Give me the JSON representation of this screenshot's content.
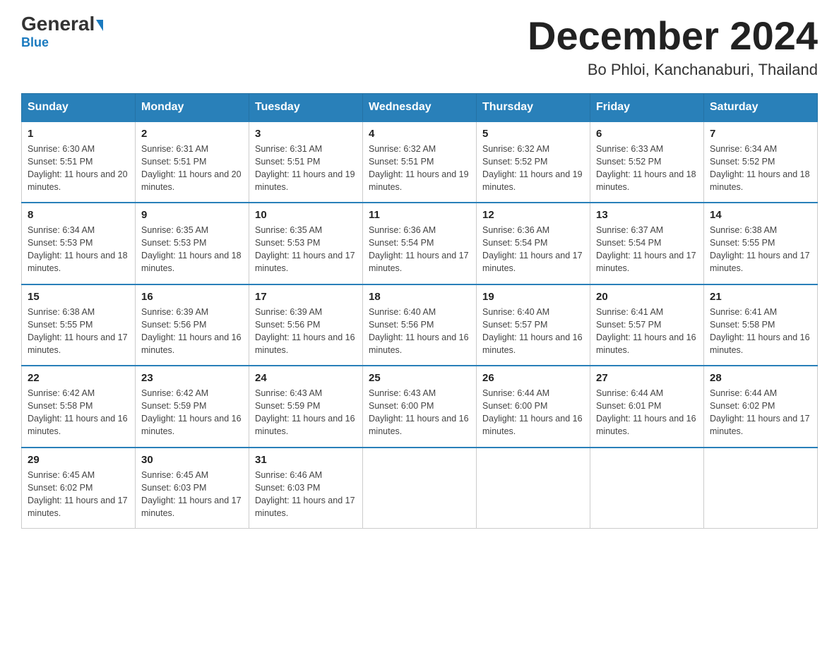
{
  "header": {
    "logo_general": "General",
    "logo_blue": "Blue",
    "month_title": "December 2024",
    "location": "Bo Phloi, Kanchanaburi, Thailand"
  },
  "weekdays": [
    "Sunday",
    "Monday",
    "Tuesday",
    "Wednesday",
    "Thursday",
    "Friday",
    "Saturday"
  ],
  "weeks": [
    [
      {
        "day": "1",
        "sunrise": "6:30 AM",
        "sunset": "5:51 PM",
        "daylight": "11 hours and 20 minutes."
      },
      {
        "day": "2",
        "sunrise": "6:31 AM",
        "sunset": "5:51 PM",
        "daylight": "11 hours and 20 minutes."
      },
      {
        "day": "3",
        "sunrise": "6:31 AM",
        "sunset": "5:51 PM",
        "daylight": "11 hours and 19 minutes."
      },
      {
        "day": "4",
        "sunrise": "6:32 AM",
        "sunset": "5:51 PM",
        "daylight": "11 hours and 19 minutes."
      },
      {
        "day": "5",
        "sunrise": "6:32 AM",
        "sunset": "5:52 PM",
        "daylight": "11 hours and 19 minutes."
      },
      {
        "day": "6",
        "sunrise": "6:33 AM",
        "sunset": "5:52 PM",
        "daylight": "11 hours and 18 minutes."
      },
      {
        "day": "7",
        "sunrise": "6:34 AM",
        "sunset": "5:52 PM",
        "daylight": "11 hours and 18 minutes."
      }
    ],
    [
      {
        "day": "8",
        "sunrise": "6:34 AM",
        "sunset": "5:53 PM",
        "daylight": "11 hours and 18 minutes."
      },
      {
        "day": "9",
        "sunrise": "6:35 AM",
        "sunset": "5:53 PM",
        "daylight": "11 hours and 18 minutes."
      },
      {
        "day": "10",
        "sunrise": "6:35 AM",
        "sunset": "5:53 PM",
        "daylight": "11 hours and 17 minutes."
      },
      {
        "day": "11",
        "sunrise": "6:36 AM",
        "sunset": "5:54 PM",
        "daylight": "11 hours and 17 minutes."
      },
      {
        "day": "12",
        "sunrise": "6:36 AM",
        "sunset": "5:54 PM",
        "daylight": "11 hours and 17 minutes."
      },
      {
        "day": "13",
        "sunrise": "6:37 AM",
        "sunset": "5:54 PM",
        "daylight": "11 hours and 17 minutes."
      },
      {
        "day": "14",
        "sunrise": "6:38 AM",
        "sunset": "5:55 PM",
        "daylight": "11 hours and 17 minutes."
      }
    ],
    [
      {
        "day": "15",
        "sunrise": "6:38 AM",
        "sunset": "5:55 PM",
        "daylight": "11 hours and 17 minutes."
      },
      {
        "day": "16",
        "sunrise": "6:39 AM",
        "sunset": "5:56 PM",
        "daylight": "11 hours and 16 minutes."
      },
      {
        "day": "17",
        "sunrise": "6:39 AM",
        "sunset": "5:56 PM",
        "daylight": "11 hours and 16 minutes."
      },
      {
        "day": "18",
        "sunrise": "6:40 AM",
        "sunset": "5:56 PM",
        "daylight": "11 hours and 16 minutes."
      },
      {
        "day": "19",
        "sunrise": "6:40 AM",
        "sunset": "5:57 PM",
        "daylight": "11 hours and 16 minutes."
      },
      {
        "day": "20",
        "sunrise": "6:41 AM",
        "sunset": "5:57 PM",
        "daylight": "11 hours and 16 minutes."
      },
      {
        "day": "21",
        "sunrise": "6:41 AM",
        "sunset": "5:58 PM",
        "daylight": "11 hours and 16 minutes."
      }
    ],
    [
      {
        "day": "22",
        "sunrise": "6:42 AM",
        "sunset": "5:58 PM",
        "daylight": "11 hours and 16 minutes."
      },
      {
        "day": "23",
        "sunrise": "6:42 AM",
        "sunset": "5:59 PM",
        "daylight": "11 hours and 16 minutes."
      },
      {
        "day": "24",
        "sunrise": "6:43 AM",
        "sunset": "5:59 PM",
        "daylight": "11 hours and 16 minutes."
      },
      {
        "day": "25",
        "sunrise": "6:43 AM",
        "sunset": "6:00 PM",
        "daylight": "11 hours and 16 minutes."
      },
      {
        "day": "26",
        "sunrise": "6:44 AM",
        "sunset": "6:00 PM",
        "daylight": "11 hours and 16 minutes."
      },
      {
        "day": "27",
        "sunrise": "6:44 AM",
        "sunset": "6:01 PM",
        "daylight": "11 hours and 16 minutes."
      },
      {
        "day": "28",
        "sunrise": "6:44 AM",
        "sunset": "6:02 PM",
        "daylight": "11 hours and 17 minutes."
      }
    ],
    [
      {
        "day": "29",
        "sunrise": "6:45 AM",
        "sunset": "6:02 PM",
        "daylight": "11 hours and 17 minutes."
      },
      {
        "day": "30",
        "sunrise": "6:45 AM",
        "sunset": "6:03 PM",
        "daylight": "11 hours and 17 minutes."
      },
      {
        "day": "31",
        "sunrise": "6:46 AM",
        "sunset": "6:03 PM",
        "daylight": "11 hours and 17 minutes."
      },
      null,
      null,
      null,
      null
    ]
  ]
}
